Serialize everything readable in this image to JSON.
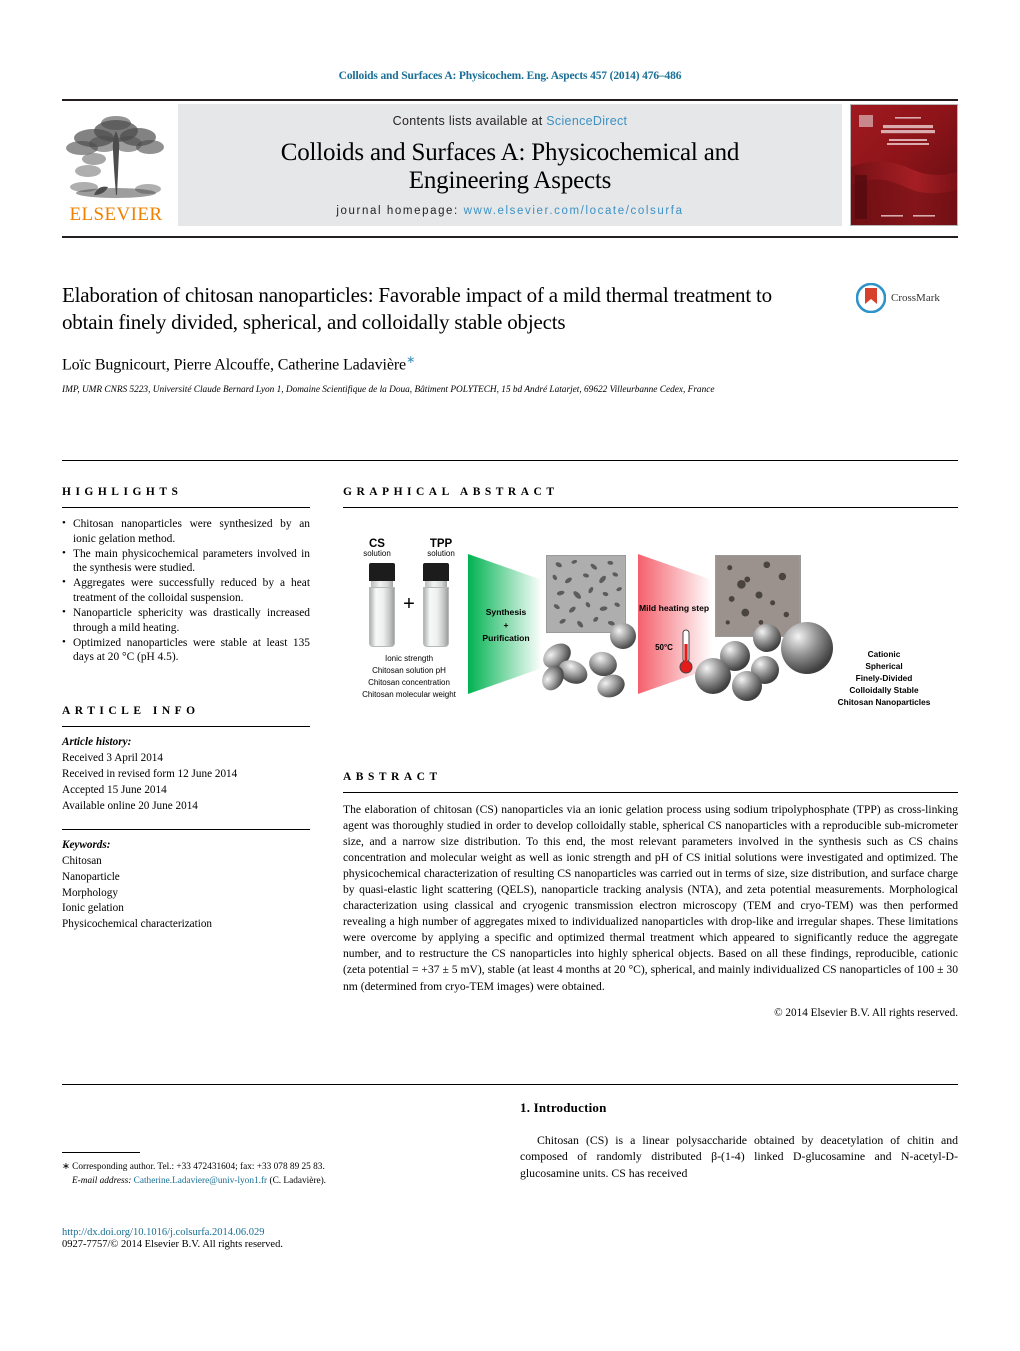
{
  "running_head": "Colloids and Surfaces A: Physicochem. Eng. Aspects 457 (2014) 476–486",
  "masthead": {
    "publisher_name": "ELSEVIER",
    "contents_prefix": "Contents lists available at ",
    "sciencedirect": "ScienceDirect",
    "journal_title_line1": "Colloids and Surfaces A: Physicochemical and",
    "journal_title_line2": "Engineering Aspects",
    "homepage_prefix": "journal homepage: ",
    "homepage_url": "www.elsevier.com/locate/colsurfa",
    "cover_title": "COLLOIDS AND SURFACES A",
    "cover_subtitle": "Physicochemical and Engineering Aspects",
    "link_color": "#3d91c4",
    "header_link_color": "#1a6f96"
  },
  "article": {
    "title": "Elaboration of chitosan nanoparticles: Favorable impact of a mild thermal treatment to obtain finely divided, spherical, and colloidally stable objects",
    "authors": "Loïc Bugnicourt, Pierre Alcouffe, Catherine Ladavière",
    "corresponding_marker": "∗",
    "affiliation": "IMP, UMR CNRS 5223, Université Claude Bernard Lyon 1, Domaine Scientifique de la Doua, Bâtiment POLYTECH, 15 bd André Latarjet, 69622 Villeurbanne Cedex, France",
    "crossmark_label": "CrossMark"
  },
  "highlights": {
    "heading": "HIGHLIGHTS",
    "items": [
      "Chitosan nanoparticles were synthesized by an ionic gelation method.",
      "The main physicochemical parameters involved in the synthesis were studied.",
      "Aggregates were successfully reduced by a heat treatment of the colloidal suspension.",
      "Nanoparticle sphericity was drastically increased through a mild heating.",
      "Optimized nanoparticles were stable at least 135 days at 20 °C (pH 4.5)."
    ]
  },
  "graphical_abstract": {
    "heading": "GRAPHICAL ABSTRACT",
    "vial_cs_name": "CS",
    "vial_cs_sub": "solution",
    "vial_tpp_name": "TPP",
    "vial_tpp_sub": "solution",
    "plus_sign": "+",
    "parameters": [
      "Ionic strength",
      "Chitosan solution pH",
      "Chitosan concentration",
      "Chitosan molecular weight"
    ],
    "step1_line1": "Synthesis",
    "step1_line2": "+",
    "step1_line3": "Purification",
    "step2_label": "Mild heating step",
    "temperature": "50°C",
    "outcome": [
      "Cationic",
      "Spherical",
      "Finely-Divided",
      "Colloidally Stable",
      "Chitosan Nanoparticles"
    ],
    "green_color": "#00b251",
    "red_color": "#f4606c"
  },
  "article_info": {
    "heading": "ARTICLE INFO",
    "history_label": "Article history:",
    "history": [
      "Received 3 April 2014",
      "Received in revised form 12 June 2014",
      "Accepted 15 June 2014",
      "Available online 20 June 2014"
    ],
    "keywords_label": "Keywords:",
    "keywords": [
      "Chitosan",
      "Nanoparticle",
      "Morphology",
      "Ionic gelation",
      "Physicochemical characterization"
    ]
  },
  "abstract": {
    "heading": "ABSTRACT",
    "text": "The elaboration of chitosan (CS) nanoparticles via an ionic gelation process using sodium tripolyphosphate (TPP) as cross-linking agent was thoroughly studied in order to develop colloidally stable, spherical CS nanoparticles with a reproducible sub-micrometer size, and a narrow size distribution. To this end, the most relevant parameters involved in the synthesis such as CS chains concentration and molecular weight as well as ionic strength and pH of CS initial solutions were investigated and optimized. The physicochemical characterization of resulting CS nanoparticles was carried out in terms of size, size distribution, and surface charge by quasi-elastic light scattering (QELS), nanoparticle tracking analysis (NTA), and zeta potential measurements. Morphological characterization using classical and cryogenic transmission electron microscopy (TEM and cryo-TEM) was then performed revealing a high number of aggregates mixed to individualized nanoparticles with drop-like and irregular shapes. These limitations were overcome by applying a specific and optimized thermal treatment which appeared to significantly reduce the aggregate number, and to restructure the CS nanoparticles into highly spherical objects. Based on all these findings, reproducible, cationic (zeta potential = +37 ± 5 mV), stable (at least 4 months at 20 °C), spherical, and mainly individualized CS nanoparticles of 100 ± 30 nm (determined from cryo-TEM images) were obtained.",
    "copyright": "© 2014 Elsevier B.V. All rights reserved."
  },
  "introduction": {
    "heading": "1. Introduction",
    "paragraph": "Chitosan (CS) is a linear polysaccharide obtained by deacetylation of chitin and composed of randomly distributed β-(1-4) linked D-glucosamine and N-acetyl-D-glucosamine units. CS has received"
  },
  "footer": {
    "corresponding_star": "∗",
    "corresponding_text": "Corresponding author. Tel.: +33 472431604; fax: +33 078 89 25 83.",
    "email_label": "E-mail address:",
    "email": "Catherine.Ladaviere@univ-lyon1.fr",
    "email_suffix": "(C. Ladavière).",
    "doi_url": "http://dx.doi.org/10.1016/j.colsurfa.2014.06.029",
    "issn_line": "0927-7757/© 2014 Elsevier B.V. All rights reserved."
  }
}
